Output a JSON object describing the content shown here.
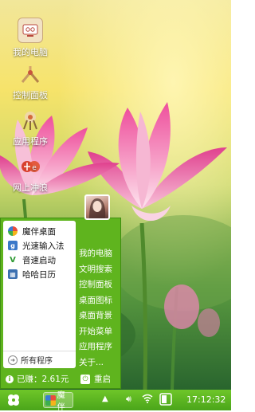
{
  "desktop": {
    "icons": [
      {
        "label": "我的电脑",
        "icon": "computer-icon"
      },
      {
        "label": "控制面板",
        "icon": "control-panel-icon"
      },
      {
        "label": "应用程序",
        "icon": "applications-icon"
      },
      {
        "label": "网上冲浪",
        "icon": "browser-icon"
      }
    ]
  },
  "start_menu": {
    "programs": [
      {
        "label": "魔伴桌面",
        "icon": "mobuzm-icon",
        "color": "#e7a21f"
      },
      {
        "label": "光速输入法",
        "icon": "input-method-icon",
        "color": "#3a78c9"
      },
      {
        "label": "音速启动",
        "icon": "launcher-icon",
        "color": "#2f9a34"
      },
      {
        "label": "哈哈日历",
        "icon": "calendar-icon",
        "color": "#3b6fb0"
      }
    ],
    "all_programs": "所有程序",
    "right_items": [
      "我的电脑",
      "文明搜索",
      "控制面板",
      "桌面图标",
      "桌面背景",
      "开始菜单",
      "应用程序",
      "关于..."
    ],
    "earned": "已赚：2.61元",
    "restart": "重启"
  },
  "taskbar": {
    "app_label": "魔伴",
    "time": "17:12:32"
  },
  "colors": {
    "menu_green": "#5fb41e",
    "taskbar_green": "#4aa51a"
  }
}
